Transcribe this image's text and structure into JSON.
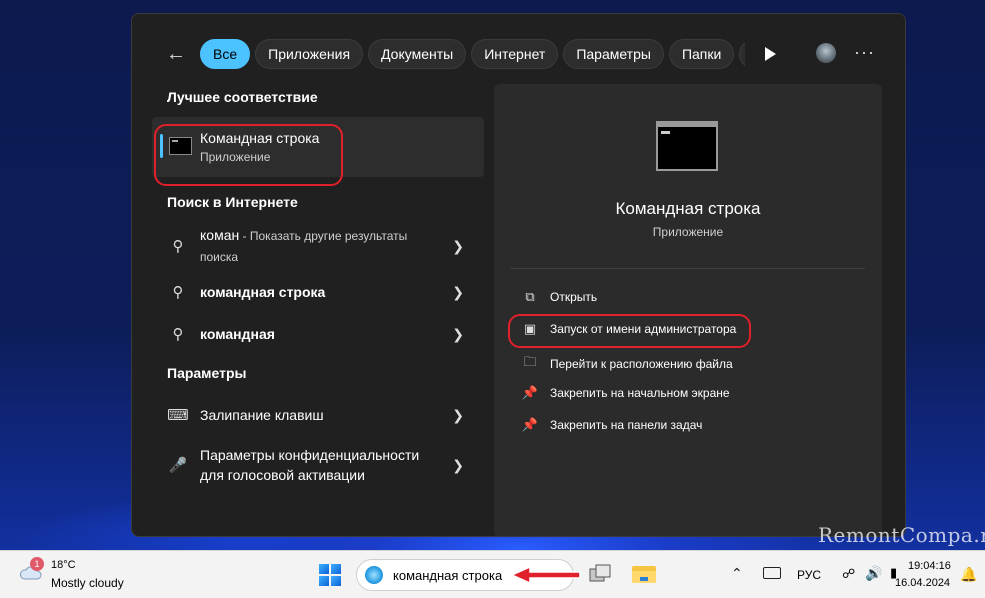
{
  "filter_bar": {
    "back_icon": "arrow-left-icon",
    "chips": [
      {
        "label": "Все",
        "active": true
      },
      {
        "label": "Приложения",
        "active": false
      },
      {
        "label": "Документы",
        "active": false
      },
      {
        "label": "Интернет",
        "active": false
      },
      {
        "label": "Параметры",
        "active": false
      },
      {
        "label": "Папки",
        "active": false
      },
      {
        "label": "Ф",
        "active": false
      }
    ],
    "more": "···"
  },
  "best_match": {
    "heading": "Лучшее соответствие",
    "title": "Командная строка",
    "subtitle": "Приложение"
  },
  "web": {
    "heading": "Поиск в Интернете",
    "items": [
      {
        "query": "коман",
        "extra": " - Показать другие результаты",
        "line2": "поиска"
      },
      {
        "query": "командная строка",
        "extra": "",
        "line2": ""
      },
      {
        "query": "командная",
        "extra": "",
        "line2": ""
      }
    ]
  },
  "settings": {
    "heading": "Параметры",
    "items": [
      {
        "line1": "Залипание клавиш",
        "line2": "",
        "icon": "keyboard-icon"
      },
      {
        "line1": "Параметры конфиденциальности",
        "line2": "для голосовой активации",
        "icon": "microphone-icon"
      }
    ]
  },
  "preview": {
    "name": "Командная строка",
    "type": "Приложение",
    "actions": [
      {
        "label": "Открыть",
        "icon": "open-external-icon"
      },
      {
        "label": "Запуск от имени администратора",
        "icon": "shield-admin-icon"
      },
      {
        "label": "Перейти к расположению файла",
        "icon": "folder-icon"
      },
      {
        "label": "Закрепить на начальном экране",
        "icon": "pin-icon"
      },
      {
        "label": "Закрепить на панели задач",
        "icon": "pin-icon"
      }
    ]
  },
  "taskbar": {
    "weather_badge": "1",
    "temperature": "18°C",
    "condition": "Mostly cloudy",
    "search_text": "командная строка",
    "language": "РУС",
    "time": "19:04:16",
    "date": "16.04.2024"
  },
  "watermark": "RemontCompa.ru",
  "colors": {
    "accent": "#4cc2ff",
    "highlight_ring": "#e0202a",
    "panel_bg": "#202020",
    "preview_bg": "#2b2b2b"
  }
}
